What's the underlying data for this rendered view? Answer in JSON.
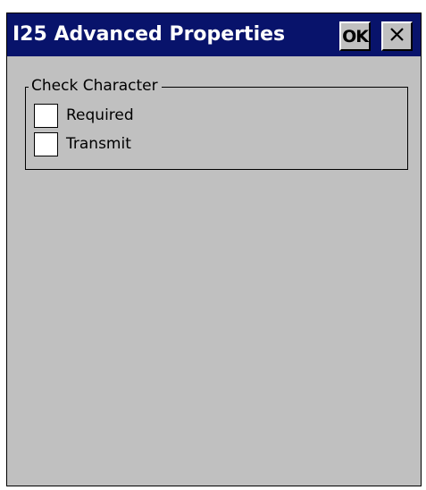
{
  "window": {
    "title": "I25 Advanced Properties",
    "ok_label": "OK",
    "close_icon": "close-icon",
    "colors": {
      "titlebar": "#08136b",
      "face": "#c0c0c0",
      "title_text": "#ffffff"
    }
  },
  "group": {
    "label": "Check Character",
    "options": [
      {
        "label": "Required",
        "checked": false
      },
      {
        "label": "Transmit",
        "checked": false
      }
    ]
  }
}
